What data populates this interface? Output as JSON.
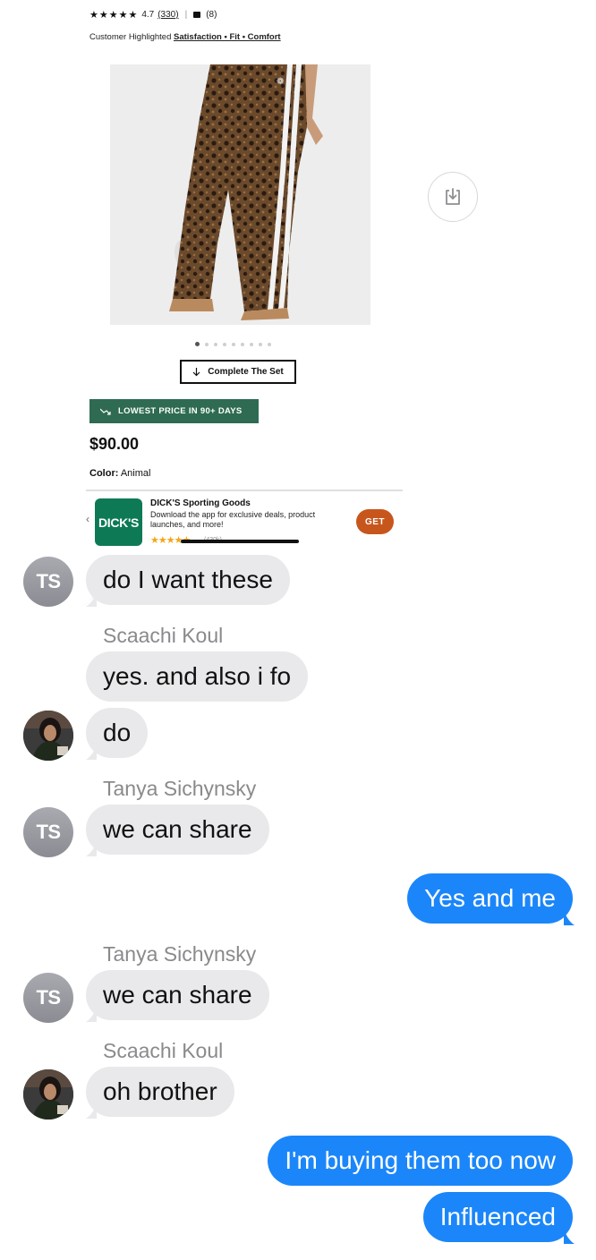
{
  "shared_product": {
    "stars": "★★★★★",
    "rating_value": "4.7",
    "rating_count": "(330)",
    "separator": "|",
    "review_photos": "(8)",
    "highlight_prefix": "Customer Highlighted",
    "highlight_terms": "Satisfaction • Fit • Comfort",
    "carousel_dots_count": 9,
    "complete_set_label": "Complete The Set",
    "promo_label": "LOWEST PRICE IN 90+ DAYS",
    "price": "$90.00",
    "color_label": "Color:",
    "color_value": "Animal",
    "app_banner": {
      "logo_text": "DICK'S",
      "title": "DICK'S Sporting Goods",
      "description": "Download the app for exclusive deals, product launches, and more!",
      "stars": "★★★★★",
      "rating_count": "(430k)",
      "get_label": "GET",
      "brand_color": "#0d7a55",
      "get_color": "#c7561d"
    }
  },
  "messages": [
    {
      "dir": "in",
      "avatar": "TS",
      "text": "do I want these"
    },
    {
      "dir": "in",
      "sender": "Scaachi Koul",
      "text": "yes. and also i fo"
    },
    {
      "dir": "in",
      "avatar": "photo",
      "text": "do"
    },
    {
      "dir": "in",
      "sender": "Tanya Sichynsky",
      "avatar": "TS",
      "text": "we can share"
    },
    {
      "dir": "out",
      "text": "Yes and me"
    },
    {
      "dir": "in",
      "sender": "Tanya Sichynsky",
      "avatar": "TS",
      "text": "we can share"
    },
    {
      "dir": "in",
      "sender": "Scaachi Koul",
      "avatar": "photo",
      "text": "oh brother"
    },
    {
      "dir": "out",
      "text": "I'm buying them too now"
    },
    {
      "dir": "out",
      "text": "Influenced"
    }
  ],
  "colors": {
    "incoming_bubble": "#e9e9eb",
    "outgoing_bubble": "#1b86f9",
    "sender_name": "#8a8a8e"
  }
}
